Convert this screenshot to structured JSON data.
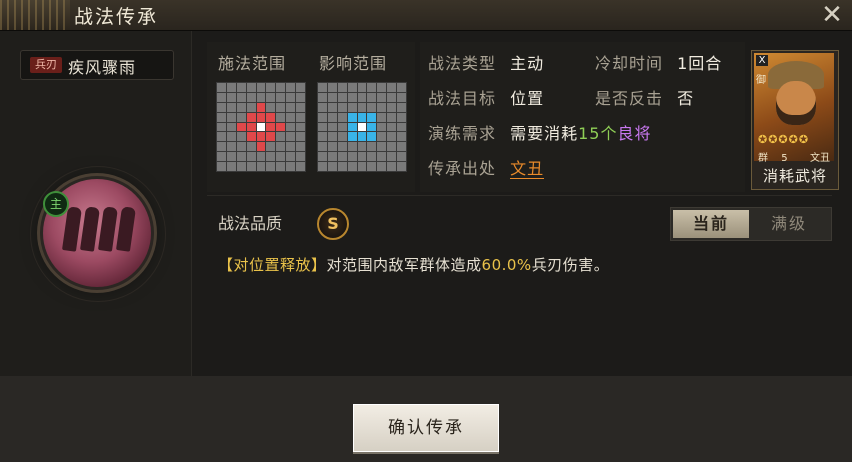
{
  "window": {
    "title": "战法传承",
    "close_icon": "close-icon"
  },
  "skill": {
    "type_badge": "兵刃",
    "name": "疾风骤雨",
    "rank_badge": "主"
  },
  "range": {
    "cast_label": "施法范围",
    "effect_label": "影响范围",
    "cast_grid": {
      "size": 9,
      "cells": {
        "red": [
          [
            2,
            4
          ],
          [
            3,
            3
          ],
          [
            3,
            4
          ],
          [
            3,
            5
          ],
          [
            4,
            2
          ],
          [
            4,
            3
          ],
          [
            4,
            5
          ],
          [
            4,
            6
          ],
          [
            5,
            3
          ],
          [
            5,
            4
          ],
          [
            5,
            5
          ],
          [
            6,
            4
          ]
        ],
        "white": [
          [
            4,
            4
          ]
        ]
      }
    },
    "effect_grid": {
      "size": 9,
      "cells": {
        "blue": [
          [
            3,
            3
          ],
          [
            3,
            4
          ],
          [
            3,
            5
          ],
          [
            4,
            3
          ],
          [
            4,
            5
          ],
          [
            5,
            3
          ],
          [
            5,
            4
          ],
          [
            5,
            5
          ]
        ],
        "white": [
          [
            4,
            4
          ]
        ]
      }
    }
  },
  "info": {
    "type_label": "战法类型",
    "type_value": "主动",
    "cooldown_label": "冷却时间",
    "cooldown_value": "1回合",
    "target_label": "战法目标",
    "target_value": "位置",
    "counter_label": "是否反击",
    "counter_value": "否",
    "train_label": "演练需求",
    "train_prefix": "需要消耗",
    "train_count": "15个",
    "train_item": "良将",
    "source_label": "传承出处",
    "source_value": "文丑"
  },
  "general": {
    "type_icon": "X",
    "defense": "御",
    "stars": "✪✪✪✪✪",
    "faction": "群",
    "level": "5",
    "name": "文丑",
    "label": "消耗武将"
  },
  "quality": {
    "label": "战法品质",
    "grade": "S"
  },
  "toggle": {
    "current": "当前",
    "max": "满级"
  },
  "description": {
    "tag": "【对位置释放】",
    "text_a": "对范围内敌军群体造成",
    "percent": "60.0%",
    "text_b": "兵刃伤害。"
  },
  "footer": {
    "confirm": "确认传承"
  },
  "colors": {
    "accent": "#e9c24a",
    "red_cell": "#e0484a",
    "blue_cell": "#39b4e8",
    "green": "#8fcf56",
    "purple": "#c878f0"
  }
}
